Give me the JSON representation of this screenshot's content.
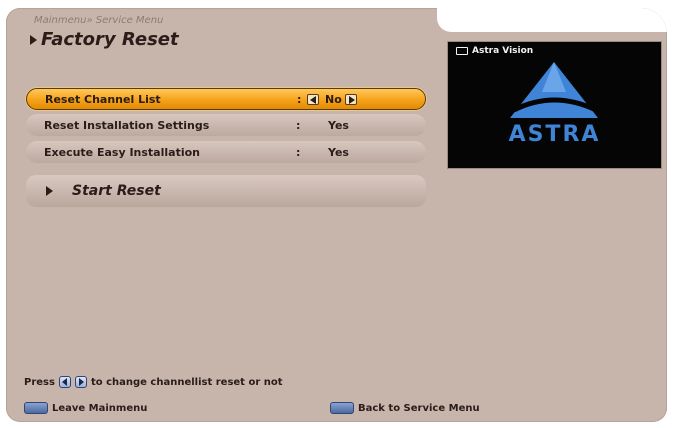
{
  "breadcrumb": "Mainmenu» Service Menu",
  "title": "Factory Reset",
  "menu": {
    "rows": [
      {
        "label": "Reset Channel List",
        "colon": ":",
        "value": "No"
      },
      {
        "label": "Reset Installation Settings",
        "colon": ":",
        "value": "Yes"
      },
      {
        "label": "Execute Easy Installation",
        "colon": ":",
        "value": "Yes"
      }
    ],
    "action_label": "Start Reset"
  },
  "preview": {
    "channel": "Astra Vision",
    "logo_text": "ASTRA",
    "logo_color": "#3f84d6"
  },
  "footer": {
    "hint_prefix": "Press",
    "hint_suffix": "to change channellist reset or not",
    "menu_key_text": "Leave Mainmenu",
    "back_key_text": "Back to Service Menu"
  },
  "colors": {
    "panel": "#c7b4ab",
    "highlight": "#f5a21a",
    "key_blue": "#4b6aa3"
  }
}
